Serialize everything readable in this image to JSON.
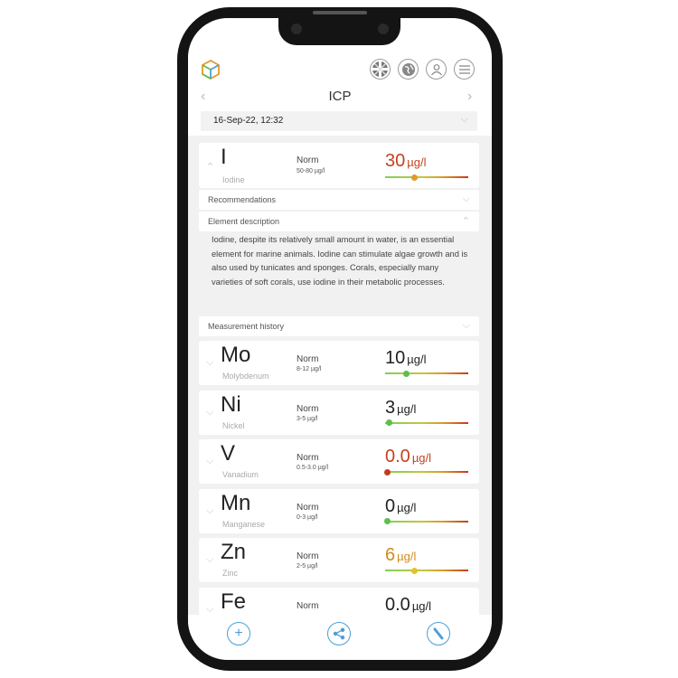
{
  "header": {
    "title": "ICP",
    "icons": [
      "logo-icon",
      "flag-uk-icon",
      "globe-icon",
      "user-icon",
      "menu-icon"
    ],
    "date": "16-Sep-22, 12:32"
  },
  "iodine": {
    "symbol": "I",
    "name": "Iodine",
    "norm_label": "Norm",
    "norm_range": "50-80 µg/l",
    "value": "30",
    "unit": "µg/l",
    "value_color": "#c4411f",
    "level": 0.35
  },
  "sections": {
    "recommendations": "Recommendations",
    "element_description": "Element description",
    "measurement_history": "Measurement history"
  },
  "description": "Iodine, despite its relatively small amount in water, is an essential element for marine animals. Iodine can stimulate algae growth and is also used by tunicates and sponges. Corals, especially many varieties of soft corals, use iodine in their metabolic processes.",
  "elements": [
    {
      "symbol": "Mo",
      "name": "Molybdenum",
      "norm_label": "Norm",
      "norm_range": "8-12 µg/l",
      "value": "10",
      "unit": "µg/l",
      "value_color": "#222222",
      "dot_color": "#5cbf4a",
      "level": 0.25
    },
    {
      "symbol": "Ni",
      "name": "Nickel",
      "norm_label": "Norm",
      "norm_range": "3-5 µg/l",
      "value": "3",
      "unit": "µg/l",
      "value_color": "#222222",
      "dot_color": "#5cbf4a",
      "level": 0.05
    },
    {
      "symbol": "V",
      "name": "Vanadium",
      "norm_label": "Norm",
      "norm_range": "0.5-3.0 µg/l",
      "value": "0.0",
      "unit": "µg/l",
      "value_color": "#c4411f",
      "dot_color": "#c63a1a",
      "level": 0.03
    },
    {
      "symbol": "Mn",
      "name": "Manganese",
      "norm_label": "Norm",
      "norm_range": "0-3 µg/l",
      "value": "0",
      "unit": "µg/l",
      "value_color": "#222222",
      "dot_color": "#5cbf4a",
      "level": 0.03
    },
    {
      "symbol": "Zn",
      "name": "Zinc",
      "norm_label": "Norm",
      "norm_range": "2-5 µg/l",
      "value": "6",
      "unit": "µg/l",
      "value_color": "#d18b1c",
      "dot_color": "#e6c12a",
      "level": 0.35
    },
    {
      "symbol": "Fe",
      "name": "",
      "norm_label": "Norm",
      "norm_range": "",
      "value": "0.0",
      "unit": "µg/l",
      "value_color": "#222222",
      "dot_color": "#5cbf4a",
      "level": 0.03
    }
  ],
  "bottom": [
    "add-icon",
    "share-icon",
    "test-tool-icon"
  ]
}
